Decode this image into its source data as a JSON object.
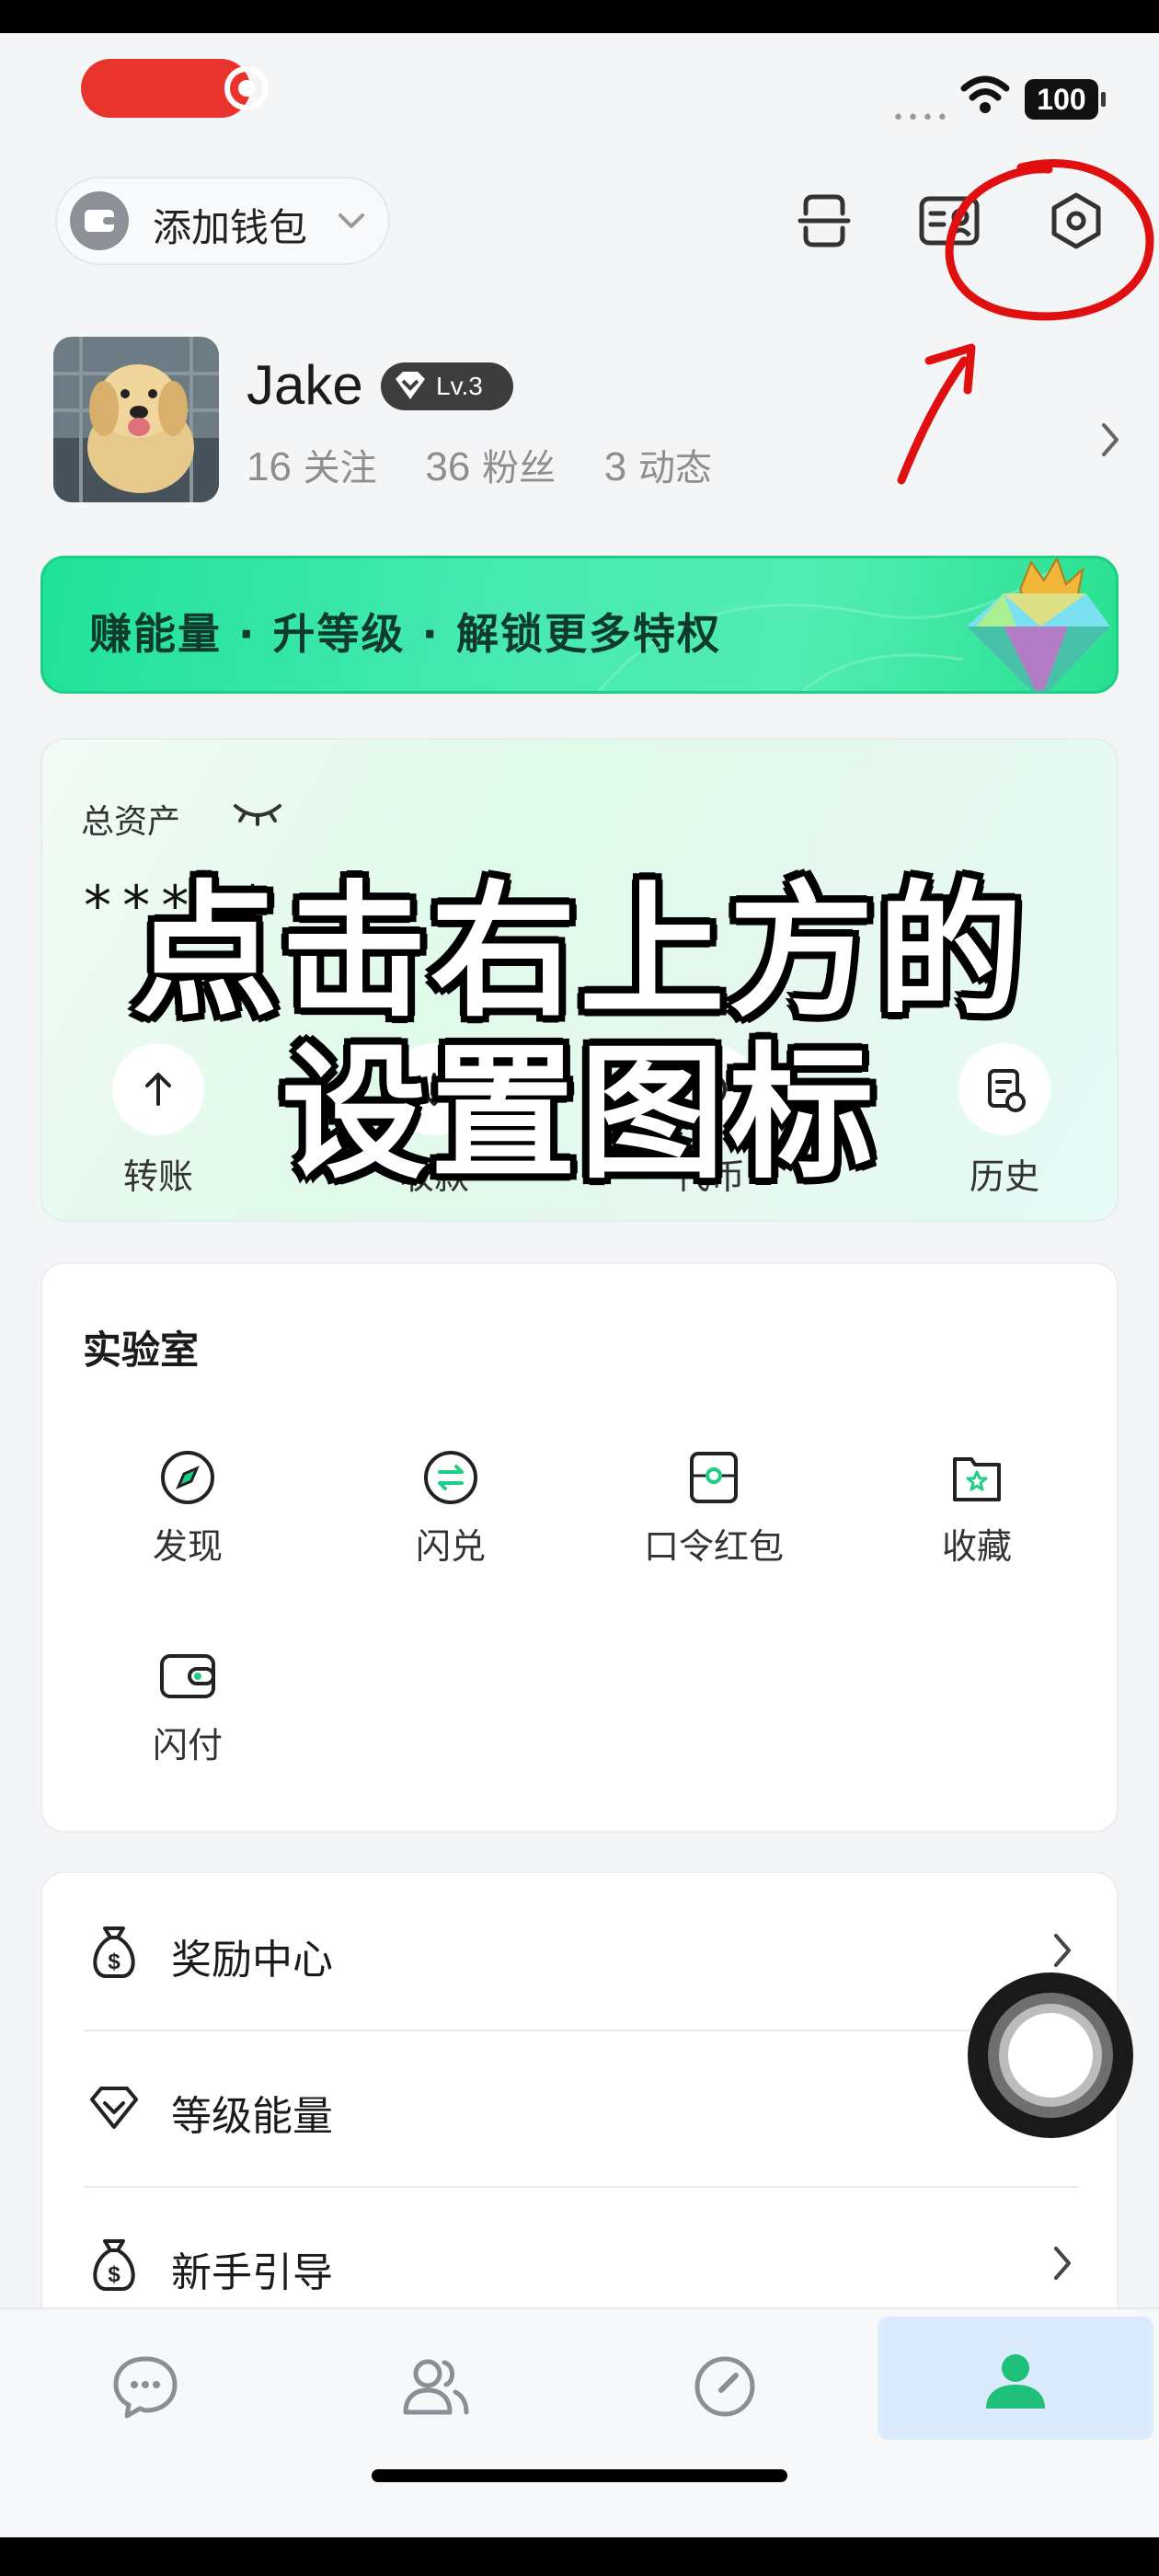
{
  "status_bar": {
    "battery": "100",
    "signal": "••••"
  },
  "header": {
    "wallet_button": "添加钱包",
    "icons": [
      "scan-icon",
      "card-icon",
      "settings-hexagon-icon"
    ]
  },
  "profile": {
    "name": "Jake",
    "level": "Lv.3",
    "following_count": "16",
    "following_label": "关注",
    "followers_count": "36",
    "followers_label": "粉丝",
    "posts_count": "3",
    "posts_label": "动态"
  },
  "banner": {
    "text": "赚能量 · 升等级 · 解锁更多特权"
  },
  "assets": {
    "label": "总资产",
    "masked_value": "*****",
    "actions": [
      {
        "label": "转账",
        "icon": "arrow-up-icon"
      },
      {
        "label": "收款",
        "icon": "receive-icon"
      },
      {
        "label": "代币",
        "icon": "token-icon"
      },
      {
        "label": "历史",
        "icon": "history-icon"
      }
    ]
  },
  "overlay_caption": {
    "line1": "点击右上方的",
    "line2": "设置图标"
  },
  "lab": {
    "title": "实验室",
    "items": [
      {
        "label": "发现",
        "icon": "compass-icon"
      },
      {
        "label": "闪兑",
        "icon": "swap-icon"
      },
      {
        "label": "口令红包",
        "icon": "red-packet-icon"
      },
      {
        "label": "收藏",
        "icon": "star-folder-icon"
      },
      {
        "label": "闪付",
        "icon": "wallet-icon"
      }
    ]
  },
  "menu": {
    "items": [
      {
        "label": "奖励中心",
        "icon": "money-bag-icon"
      },
      {
        "label": "等级能量",
        "icon": "diamond-icon"
      },
      {
        "label": "新手引导",
        "icon": "money-bag-icon"
      }
    ]
  },
  "tabbar": {
    "tabs": [
      {
        "icon": "chat-icon",
        "active": false
      },
      {
        "icon": "contacts-icon",
        "active": false
      },
      {
        "icon": "discover-compass-icon",
        "active": false
      },
      {
        "icon": "profile-icon",
        "active": true
      }
    ]
  },
  "colors": {
    "accent": "#1fce85",
    "annotation_red": "#e01010",
    "active_tab_bg": "#dcebfb"
  }
}
